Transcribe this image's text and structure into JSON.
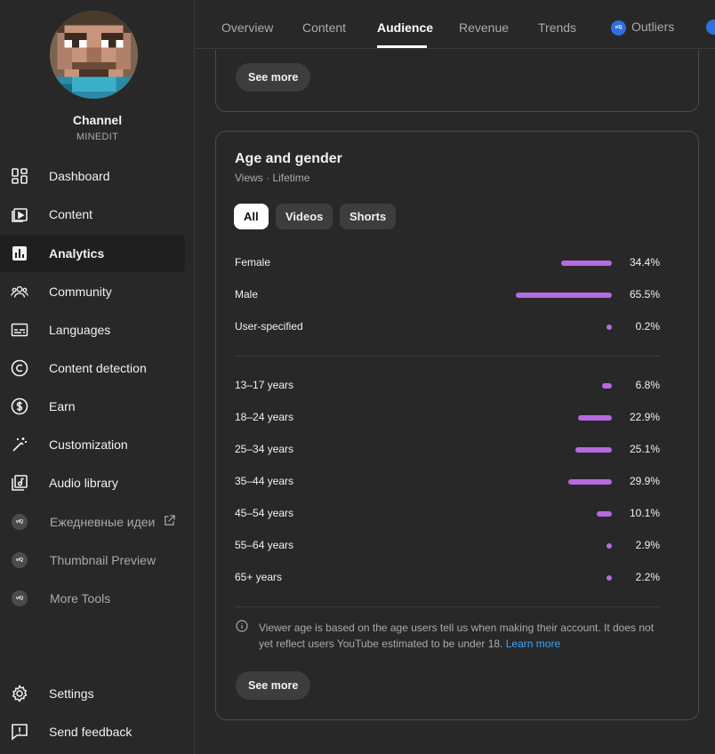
{
  "sidebar": {
    "channel_title": "Channel",
    "channel_name": "MINEDIT",
    "items": [
      {
        "label": "Dashboard",
        "icon": "dashboard-icon"
      },
      {
        "label": "Content",
        "icon": "content-icon"
      },
      {
        "label": "Analytics",
        "icon": "analytics-icon",
        "active": true
      },
      {
        "label": "Community",
        "icon": "community-icon"
      },
      {
        "label": "Languages",
        "icon": "languages-icon"
      },
      {
        "label": "Content detection",
        "icon": "copyright-icon"
      },
      {
        "label": "Earn",
        "icon": "dollar-icon"
      },
      {
        "label": "Customization",
        "icon": "magic-wand-icon"
      },
      {
        "label": "Audio library",
        "icon": "audio-library-icon"
      }
    ],
    "extensions": [
      {
        "label": "Ежедневные идеи",
        "badge": "viQ"
      },
      {
        "label": "Thumbnail Preview",
        "badge": "viQ"
      },
      {
        "label": "More Tools",
        "badge": "viQ"
      }
    ],
    "bottom": [
      {
        "label": "Settings",
        "icon": "gear-icon"
      },
      {
        "label": "Send feedback",
        "icon": "feedback-icon"
      }
    ]
  },
  "tabs": {
    "items": [
      "Overview",
      "Content",
      "Audience",
      "Revenue",
      "Trends",
      "Outliers"
    ],
    "active": "Audience",
    "outliers_badge": "viQ"
  },
  "top_card": {
    "see_more": "See more"
  },
  "age_gender": {
    "title": "Age and gender",
    "subtitle": "Views · Lifetime",
    "chips": [
      "All",
      "Videos",
      "Shorts"
    ],
    "selected_chip": "All",
    "gender": [
      {
        "label": "Female",
        "value": 34.4,
        "display": "34.4%"
      },
      {
        "label": "Male",
        "value": 65.5,
        "display": "65.5%"
      },
      {
        "label": "User-specified",
        "value": 0.2,
        "display": "0.2%"
      }
    ],
    "age": [
      {
        "label": "13–17 years",
        "value": 6.8,
        "display": "6.8%"
      },
      {
        "label": "18–24 years",
        "value": 22.9,
        "display": "22.9%"
      },
      {
        "label": "25–34 years",
        "value": 25.1,
        "display": "25.1%"
      },
      {
        "label": "35–44 years",
        "value": 29.9,
        "display": "29.9%"
      },
      {
        "label": "45–54 years",
        "value": 10.1,
        "display": "10.1%"
      },
      {
        "label": "55–64 years",
        "value": 2.9,
        "display": "2.9%"
      },
      {
        "label": "65+ years",
        "value": 2.2,
        "display": "2.2%"
      }
    ],
    "note": "Viewer age is based on the age users tell us when making their account. It does not yet reflect users YouTube estimated to be under 18.",
    "learn_more": "Learn more",
    "see_more": "See more"
  },
  "colors": {
    "bar": "#b56ae0",
    "link": "#3ea6ff",
    "background": "#282828"
  }
}
